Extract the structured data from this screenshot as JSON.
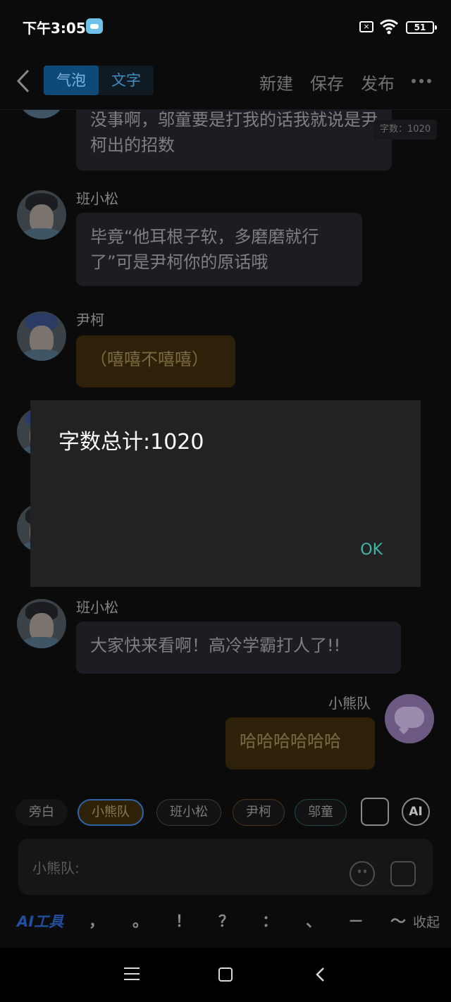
{
  "status_bar": {
    "time": "下午3:05",
    "battery": "51"
  },
  "header": {
    "tabs": [
      "气泡",
      "文字"
    ],
    "active_tab": "气泡",
    "actions": [
      "新建",
      "保存",
      "发布"
    ]
  },
  "messages": [
    {
      "speaker": "",
      "text": "没事啊，邬童要是打我的话我就说是尹柯出的招数",
      "word_count_badge": "字数：1020"
    },
    {
      "speaker": "班小松",
      "text": "毕竟“他耳根子软，多磨磨就行了”可是尹柯你的原话哦"
    },
    {
      "speaker": "尹柯",
      "text": "（嘻嘻不嘻嘻）"
    },
    {
      "speaker": "班小松",
      "text": "大家快来看啊！高冷学霸打人了!!"
    },
    {
      "speaker": "小熊队",
      "text": "哈哈哈哈哈哈"
    }
  ],
  "dialog": {
    "title": "字数总计:1020",
    "ok_label": "OK"
  },
  "characters": [
    "旁白",
    "小熊队",
    "班小松",
    "尹柯",
    "邬童"
  ],
  "active_character": "小熊队",
  "ai_button": "AI",
  "input": {
    "label": "小熊队:"
  },
  "toolbar": {
    "ai_tools": "AI工具",
    "punctuation": [
      "，",
      "。",
      "！",
      "？",
      "：",
      "、",
      "－",
      "～"
    ],
    "collapse": "收起"
  },
  "colors": {
    "accent_blue": "#0e4a79",
    "ok_teal": "#3fb6a4",
    "highlight_bubble": "#2d2209"
  }
}
